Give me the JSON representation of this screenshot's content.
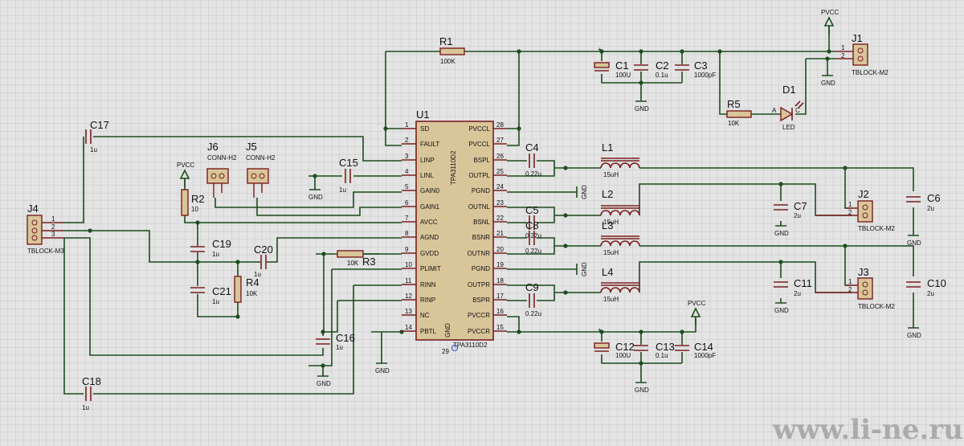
{
  "power": {
    "vcc": "PVCC",
    "gnd": "GND"
  },
  "u1": {
    "ref": "U1",
    "part": "TPA3110D2",
    "part_vertical": "TPA3110D2",
    "left_pins": [
      {
        "num": "1",
        "name": "SD"
      },
      {
        "num": "2",
        "name": "FAULT"
      },
      {
        "num": "3",
        "name": "LINP"
      },
      {
        "num": "4",
        "name": "LINL"
      },
      {
        "num": "5",
        "name": "GAIN0"
      },
      {
        "num": "6",
        "name": "GAIN1"
      },
      {
        "num": "7",
        "name": "AVCC"
      },
      {
        "num": "8",
        "name": "AGND"
      },
      {
        "num": "9",
        "name": "GVDD"
      },
      {
        "num": "10",
        "name": "PLIMIT"
      },
      {
        "num": "11",
        "name": "RINN"
      },
      {
        "num": "12",
        "name": "RINP"
      },
      {
        "num": "13",
        "name": "NC"
      },
      {
        "num": "14",
        "name": "PBTL"
      }
    ],
    "right_pins": [
      {
        "num": "28",
        "name": "PVCCL"
      },
      {
        "num": "27",
        "name": "PVCCL"
      },
      {
        "num": "26",
        "name": "BSPL"
      },
      {
        "num": "25",
        "name": "OUTPL"
      },
      {
        "num": "24",
        "name": "PGND"
      },
      {
        "num": "23",
        "name": "OUTNL"
      },
      {
        "num": "22",
        "name": "BSNL"
      },
      {
        "num": "21",
        "name": "BSNR"
      },
      {
        "num": "20",
        "name": "OUTNR"
      },
      {
        "num": "19",
        "name": "PGND"
      },
      {
        "num": "18",
        "name": "OUTPR"
      },
      {
        "num": "17",
        "name": "BSPR"
      },
      {
        "num": "16",
        "name": "PVCCR"
      },
      {
        "num": "15",
        "name": "PVCCR"
      }
    ],
    "bottom_label": "GND",
    "bottom_pin": "29"
  },
  "components": {
    "R1": {
      "ref": "R1",
      "value": "100K"
    },
    "R2": {
      "ref": "R2",
      "value": "10"
    },
    "R3": {
      "ref": "R3",
      "value": "10K"
    },
    "R4": {
      "ref": "R4",
      "value": "10K"
    },
    "R5": {
      "ref": "R5",
      "value": "10K"
    },
    "C1": {
      "ref": "C1",
      "value": "100U"
    },
    "C2": {
      "ref": "C2",
      "value": "0.1u"
    },
    "C3": {
      "ref": "C3",
      "value": "1000pF"
    },
    "C4": {
      "ref": "C4",
      "value": "0.22u"
    },
    "C5": {
      "ref": "C5",
      "value": "0.22u"
    },
    "C6": {
      "ref": "C6",
      "value": "2u"
    },
    "C7": {
      "ref": "C7",
      "value": "2u"
    },
    "C8": {
      "ref": "C8",
      "value": "0.22u"
    },
    "C9": {
      "ref": "C9",
      "value": "0.22u"
    },
    "C10": {
      "ref": "C10",
      "value": "2u"
    },
    "C11": {
      "ref": "C11",
      "value": "2u"
    },
    "C12": {
      "ref": "C12",
      "value": "100U"
    },
    "C13": {
      "ref": "C13",
      "value": "0.1u"
    },
    "C14": {
      "ref": "C14",
      "value": "1000pF"
    },
    "C15": {
      "ref": "C15",
      "value": "1u"
    },
    "C16": {
      "ref": "C16",
      "value": "1u"
    },
    "C17": {
      "ref": "C17",
      "value": "1u"
    },
    "C18": {
      "ref": "C18",
      "value": "1u"
    },
    "C19": {
      "ref": "C19",
      "value": "1u"
    },
    "C20": {
      "ref": "C20",
      "value": "1u"
    },
    "C21": {
      "ref": "C21",
      "value": "1u"
    },
    "L1": {
      "ref": "L1",
      "value": "15uH"
    },
    "L2": {
      "ref": "L2",
      "value": "15uH"
    },
    "L3": {
      "ref": "L3",
      "value": "15uH"
    },
    "L4": {
      "ref": "L4",
      "value": "15uH"
    },
    "D1": {
      "ref": "D1",
      "value": "LED",
      "anode": "A",
      "cathode": "C"
    },
    "J1": {
      "ref": "J1",
      "value": "TBLOCK-M2"
    },
    "J2": {
      "ref": "J2",
      "value": "TBLOCK-M2"
    },
    "J3": {
      "ref": "J3",
      "value": "TBLOCK-M2"
    },
    "J4": {
      "ref": "J4",
      "value": "TBLOCK-M3"
    },
    "J5": {
      "ref": "J5",
      "value": "CONN-H2"
    },
    "J6": {
      "ref": "J6",
      "value": "CONN-H2"
    }
  },
  "pin_labels": {
    "p1": "1",
    "p2": "2",
    "p3": "3"
  },
  "watermark": "www.li-ne.ru"
}
